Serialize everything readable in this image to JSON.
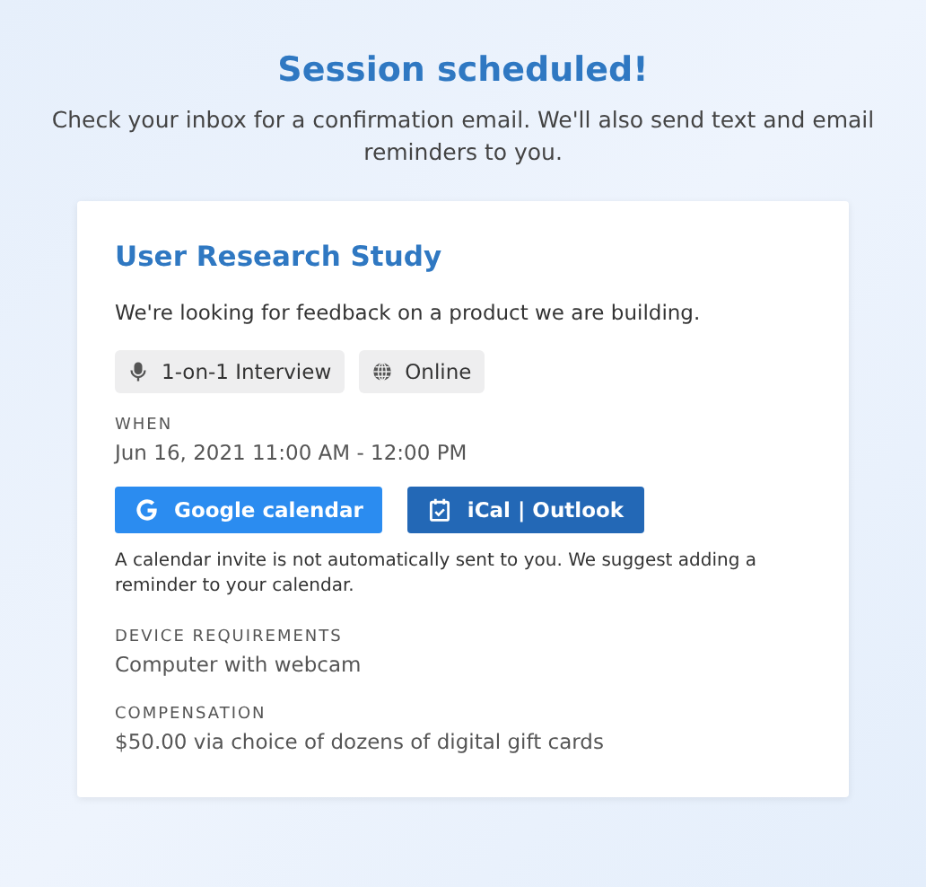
{
  "header": {
    "title": "Session scheduled!",
    "subtitle": "Check your inbox for a confirmation email. We'll also send text and email reminders to you."
  },
  "card": {
    "title": "User Research Study",
    "description": "We're looking for feedback on a product we are building.",
    "tags": [
      {
        "kind": "interview",
        "label": "1-on-1 Interview"
      },
      {
        "kind": "online",
        "label": "Online"
      }
    ],
    "when": {
      "label": "WHEN",
      "value": "Jun 16, 2021 11:00 AM - 12:00 PM"
    },
    "buttons": [
      {
        "kind": "google",
        "label": "Google calendar"
      },
      {
        "kind": "ical",
        "label": "iCal | Outlook"
      }
    ],
    "note": "A calendar invite is not automatically sent to you. We suggest adding a reminder to your calendar.",
    "details": [
      {
        "label": "DEVICE REQUIREMENTS",
        "value": "Computer with webcam"
      },
      {
        "label": "COMPENSATION",
        "value": "$50.00 via choice of dozens of digital gift cards"
      }
    ]
  }
}
